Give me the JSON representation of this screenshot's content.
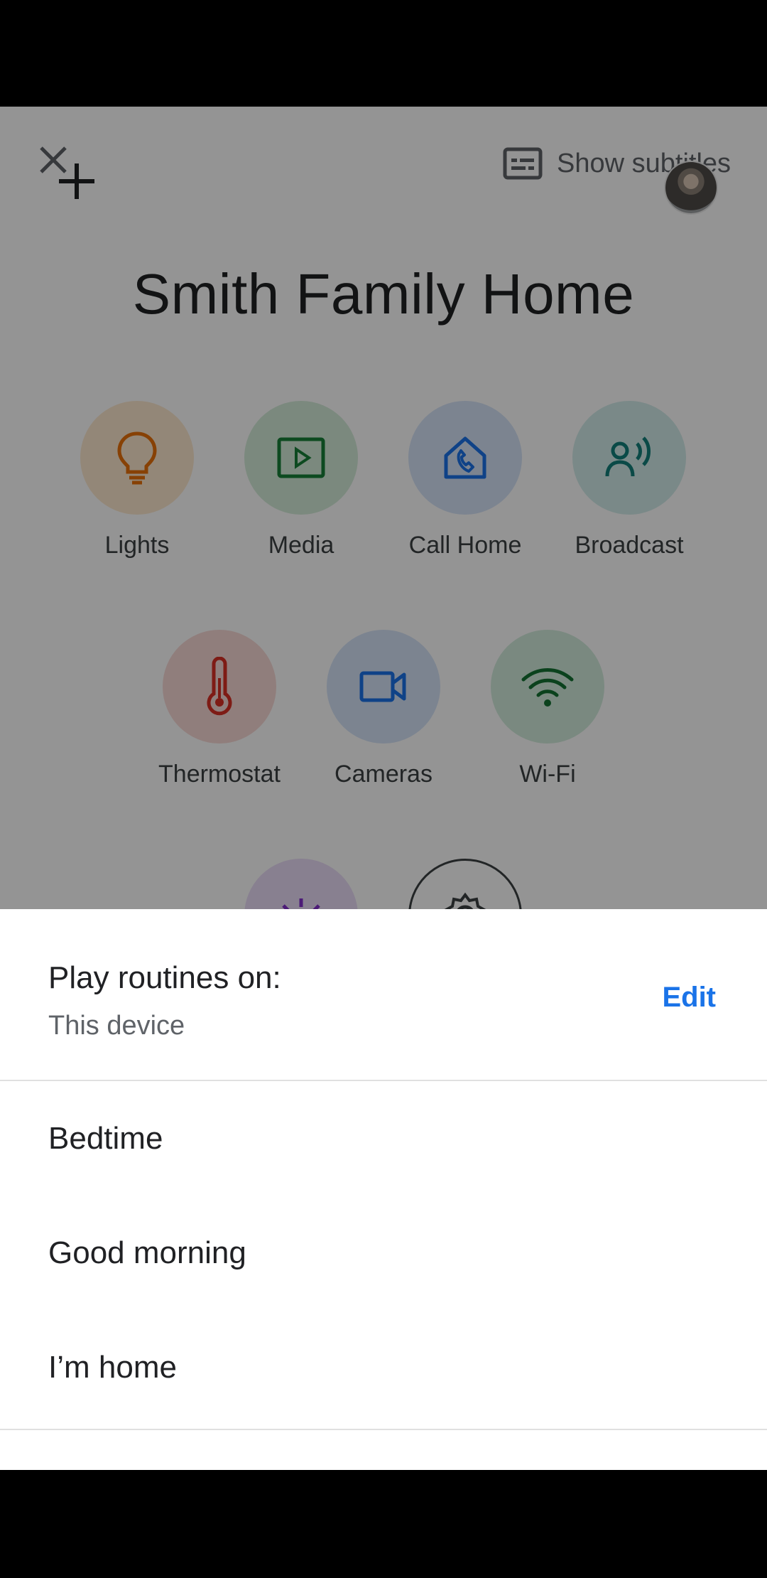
{
  "home": {
    "title": "Smith Family Home",
    "subtitles_label": "Show subtitles",
    "tiles": [
      {
        "label": "Lights",
        "icon": "lightbulb-icon",
        "color": "#e8710a",
        "bg": "#fde9cf"
      },
      {
        "label": "Media",
        "icon": "play-icon",
        "color": "#188038",
        "bg": "#d4ecd9"
      },
      {
        "label": "Call Home",
        "icon": "call-home-icon",
        "color": "#1a73e8",
        "bg": "#d6e4f8"
      },
      {
        "label": "Broadcast",
        "icon": "broadcast-icon",
        "color": "#12807a",
        "bg": "#d3ecea"
      },
      {
        "label": "Thermostat",
        "icon": "thermometer-icon",
        "color": "#d93025",
        "bg": "#f9d9d6"
      },
      {
        "label": "Cameras",
        "icon": "video-camera-icon",
        "color": "#1a73e8",
        "bg": "#d6e4f8"
      },
      {
        "label": "Wi-Fi",
        "icon": "wifi-icon",
        "color": "#137333",
        "bg": "#d3ecdd"
      }
    ]
  },
  "sheet": {
    "title": "Play routines on:",
    "subtitle": "This device",
    "edit_label": "Edit",
    "routines": [
      "Bedtime",
      "Good morning",
      "I’m home"
    ]
  }
}
